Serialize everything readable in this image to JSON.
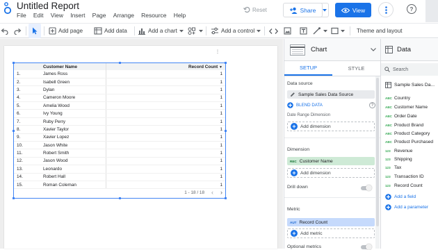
{
  "app": {
    "title": "Untitled Report"
  },
  "menu": [
    "File",
    "Edit",
    "View",
    "Insert",
    "Page",
    "Arrange",
    "Resource",
    "Help"
  ],
  "header": {
    "reset_label": "Reset",
    "share_label": "Share",
    "view_label": "View"
  },
  "toolbar": {
    "add_page": "Add page",
    "add_data": "Add data",
    "add_chart": "Add a chart",
    "add_control": "Add a control",
    "theme": "Theme and layout"
  },
  "table": {
    "headers": [
      "",
      "Customer Name",
      "Record Count"
    ],
    "rows": [
      {
        "idx": "1.",
        "name": "James Ross",
        "count": "1"
      },
      {
        "idx": "2.",
        "name": "Isabell Green",
        "count": "1"
      },
      {
        "idx": "3.",
        "name": "Dylan",
        "count": "1"
      },
      {
        "idx": "4.",
        "name": "Cameron Moore",
        "count": "1"
      },
      {
        "idx": "5.",
        "name": "Amelia Wood",
        "count": "1"
      },
      {
        "idx": "6.",
        "name": "Ivy Young",
        "count": "1"
      },
      {
        "idx": "7.",
        "name": "Ruby Perry",
        "count": "1"
      },
      {
        "idx": "8.",
        "name": "Xavier Taylor",
        "count": "1"
      },
      {
        "idx": "9.",
        "name": "Xavier Lopez",
        "count": "1"
      },
      {
        "idx": "10.",
        "name": "Jason White",
        "count": "1"
      },
      {
        "idx": "11.",
        "name": "Robert Smith",
        "count": "1"
      },
      {
        "idx": "12.",
        "name": "Jason Wood",
        "count": "1"
      },
      {
        "idx": "13.",
        "name": "Leonardo",
        "count": "1"
      },
      {
        "idx": "14.",
        "name": "Robert Hall",
        "count": "1"
      },
      {
        "idx": "15.",
        "name": "Roman Coleman",
        "count": "1"
      }
    ],
    "pagination": "1 - 18 / 18"
  },
  "props": {
    "title": "Chart",
    "tabs": [
      "SETUP",
      "STYLE"
    ],
    "data_source_label": "Data source",
    "data_source": "Sample Sales Data Source",
    "blend": "BLEND DATA",
    "date_range_label": "Date Range Dimension",
    "add_dimension": "Add dimension",
    "dimension_label": "Dimension",
    "dimension_type": "REC",
    "dimension_value": "Customer Name",
    "drill_down": "Drill down",
    "metric_label": "Metric",
    "metric_type": "AUT",
    "metric_value": "Record Count",
    "add_metric": "Add metric",
    "optional_metrics": "Optional metrics"
  },
  "data_panel": {
    "title": "Data",
    "search_placeholder": "Search",
    "source": "Sample Sales Da...",
    "fields": [
      {
        "type": "ABC",
        "name": "Country"
      },
      {
        "type": "ABC",
        "name": "Customer Name"
      },
      {
        "type": "ABC",
        "name": "Order Date"
      },
      {
        "type": "ABC",
        "name": "Product Brand"
      },
      {
        "type": "ABC",
        "name": "Product Category"
      },
      {
        "type": "ABC",
        "name": "Product Purchased"
      },
      {
        "type": "123",
        "name": "Revenue"
      },
      {
        "type": "123",
        "name": "Shipping"
      },
      {
        "type": "123",
        "name": "Tax"
      },
      {
        "type": "123",
        "name": "Transaction ID"
      },
      {
        "type": "123",
        "name": "Record Count"
      }
    ],
    "add_field": "Add a field",
    "add_parameter": "Add a parameter"
  },
  "colors": {
    "accent": "#1a73e8",
    "dimension_chip": "#ceead6",
    "metric_chip": "#c6dafc",
    "canvas": "#eeeeee"
  }
}
